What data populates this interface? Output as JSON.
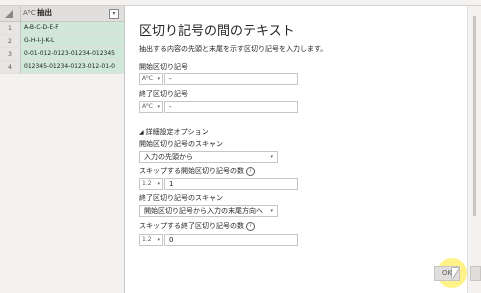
{
  "grid": {
    "column_type": "AᴮC",
    "column_name": "抽出",
    "rows": [
      {
        "num": "1",
        "value": "A-B-C-D-E-F"
      },
      {
        "num": "2",
        "value": "G-H-I-J-K-L"
      },
      {
        "num": "3",
        "value": "0-01-012-0123-01234-012345"
      },
      {
        "num": "4",
        "value": "012345-01234-0123-012-01-0"
      }
    ]
  },
  "dialog": {
    "title": "区切り記号の間のテキスト",
    "description": "抽出する内容の先頭と末尾を示す区切り記号を入力します。",
    "start_label": "開始区切り記号",
    "start_type": "AᴮC",
    "start_value": "-",
    "end_label": "終了区切り記号",
    "end_type": "AᴮC",
    "end_value": "-",
    "advanced_label": "詳細設定オプション",
    "scan_start_label": "開始区切り記号のスキャン",
    "scan_start_value": "入力の先頭から",
    "skip_start_label": "スキップする開始区切り記号の数",
    "skip_start_type": "1.2",
    "skip_start_value": "1",
    "scan_end_label": "終了区切り記号のスキャン",
    "scan_end_value": "開始区切り記号から入力の末尾方向へ",
    "skip_end_label": "スキップする終了区切り記号の数",
    "skip_end_type": "1.2",
    "skip_end_value": "0",
    "ok_label": "OK"
  }
}
